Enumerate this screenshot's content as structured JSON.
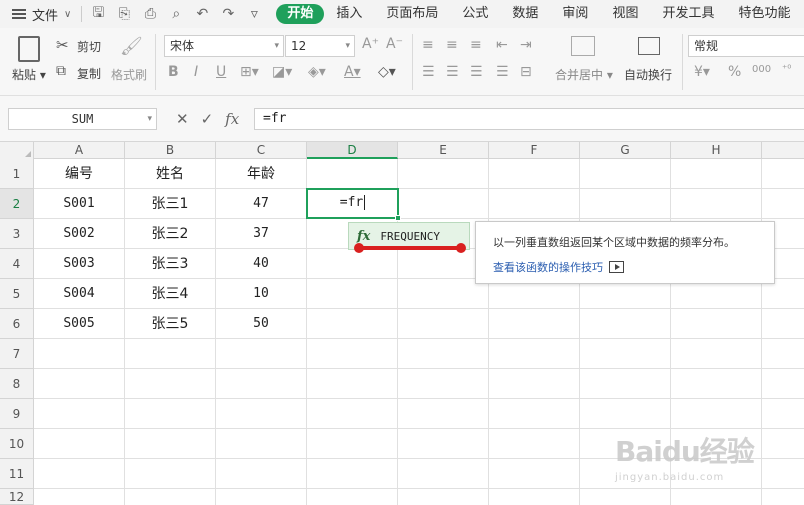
{
  "menubar": {
    "file_label": "文件",
    "tabs": [
      "开始",
      "插入",
      "页面布局",
      "公式",
      "数据",
      "审阅",
      "视图",
      "开发工具",
      "特色功能"
    ],
    "active_tab": "开始"
  },
  "ribbon": {
    "paste_label": "粘贴",
    "cut_label": "剪切",
    "copy_label": "复制",
    "format_painter_label": "格式刷",
    "font_name": "宋体",
    "font_size": "12",
    "merge_center_label": "合并居中",
    "wrap_text_label": "自动换行",
    "number_format": "常规"
  },
  "formula_bar": {
    "name_box": "SUM",
    "formula": "=fr"
  },
  "columns": [
    "A",
    "B",
    "C",
    "D",
    "E",
    "F",
    "G",
    "H"
  ],
  "rows": [
    "1",
    "2",
    "3",
    "4",
    "5",
    "6",
    "7",
    "8",
    "9",
    "10",
    "11",
    "12"
  ],
  "table": {
    "headers": [
      "编号",
      "姓名",
      "年龄"
    ],
    "data": [
      [
        "S001",
        "张三1",
        "47"
      ],
      [
        "S002",
        "张三2",
        "37"
      ],
      [
        "S003",
        "张三3",
        "40"
      ],
      [
        "S004",
        "张三4",
        "10"
      ],
      [
        "S005",
        "张三5",
        "50"
      ]
    ]
  },
  "active_cell": {
    "ref": "D2",
    "value": "=fr"
  },
  "autocomplete": {
    "icon": "fx",
    "function_name": "FREQUENCY"
  },
  "tooltip": {
    "description": "以一列垂直数组返回某个区域中数据的频率分布。",
    "link_text": "查看该函数的操作技巧"
  },
  "watermark": {
    "brand": "Baidu经验",
    "sub": "jingyan.baidu.com"
  },
  "colors": {
    "accent": "#1fa05b",
    "highlight": "#d9201f",
    "link": "#2a5db0"
  }
}
